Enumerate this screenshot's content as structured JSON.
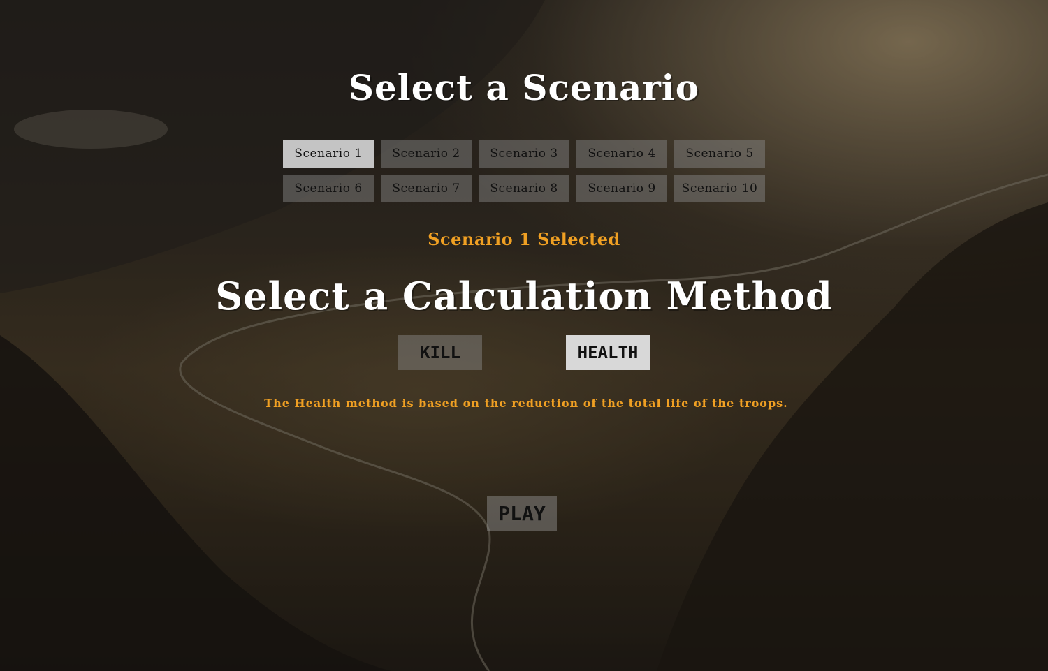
{
  "page": {
    "scenario_title": "Select a Scenario",
    "method_title": "Select a Calculation Method",
    "selected_text": "Scenario 1 Selected",
    "method_description": "The Health method is based on the reduction of the total life of the troops.",
    "play_label": "PLAY"
  },
  "scenarios": [
    {
      "label": "Scenario 1",
      "selected": true
    },
    {
      "label": "Scenario 2",
      "selected": false
    },
    {
      "label": "Scenario 3",
      "selected": false
    },
    {
      "label": "Scenario 4",
      "selected": false
    },
    {
      "label": "Scenario 5",
      "selected": false
    },
    {
      "label": "Scenario 6",
      "selected": false
    },
    {
      "label": "Scenario 7",
      "selected": false
    },
    {
      "label": "Scenario 8",
      "selected": false
    },
    {
      "label": "Scenario 9",
      "selected": false
    },
    {
      "label": "Scenario 10",
      "selected": false
    }
  ],
  "methods": {
    "kill": {
      "label": "KILL",
      "selected": false
    },
    "health": {
      "label": "HEALTH",
      "selected": true
    }
  },
  "colors": {
    "accent": "#f0a023",
    "title": "#ffffff",
    "button_active": "#c4c4c4"
  }
}
